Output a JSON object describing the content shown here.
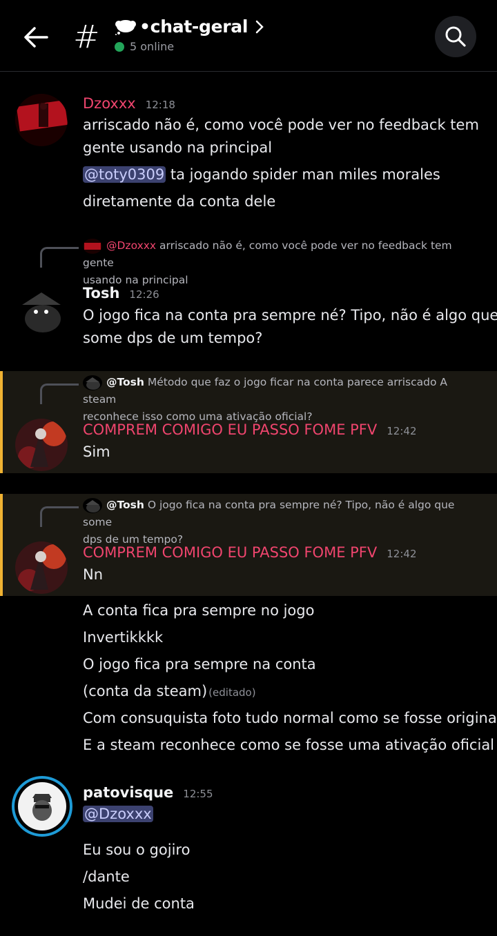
{
  "header": {
    "channel_name": "•chat-geral",
    "online_text": "5 online"
  },
  "messages": [
    {
      "author": "Dzoxxx",
      "time": "12:18",
      "lines": [
        "arriscado não é, como você pode ver no feedback tem",
        "gente usando na principal"
      ],
      "mention": "@toty0309",
      "line_after_mention": " ta jogando spider man miles morales",
      "line_last": "diretamente da conta dele"
    },
    {
      "reply_author": "@Dzoxxx",
      "reply_line1": "arriscado não é, como você pode ver no feedback tem gente",
      "reply_line2": "usando na principal",
      "author": "Tosh",
      "time": "12:26",
      "lines": [
        "O jogo fica na conta pra sempre né? Tipo, não é algo que",
        "some dps de um tempo?"
      ]
    },
    {
      "reply_author": "@Tosh",
      "reply_line1": "Método que faz o jogo ficar na conta parece arriscado A steam",
      "reply_line2": "reconhece isso como uma ativação oficial?",
      "author": "COMPREM COMIGO EU PASSO FOME PFV",
      "time": "12:42",
      "lines": [
        "Sim"
      ]
    },
    {
      "reply_author": "@Tosh",
      "reply_line1": "O jogo fica na conta pra sempre né? Tipo, não é algo que some",
      "reply_line2": "dps de um tempo?",
      "author": "COMPREM COMIGO EU PASSO FOME PFV",
      "time": "12:42",
      "lines": [
        "Nn",
        "A conta fica pra sempre no jogo",
        "Invertikkkk",
        "O jogo fica pra sempre na conta",
        "(conta da steam)",
        "Com consuquista foto tudo normal como se fosse original",
        "E a steam reconhece como se fosse uma ativação oficial"
      ],
      "edited": "(editado)"
    },
    {
      "author": "patovisque",
      "time": "12:55",
      "mention": "@Dzoxxx",
      "lines": [
        "Eu sou o gojiro",
        "/dante",
        "Mudei de conta"
      ]
    }
  ]
}
